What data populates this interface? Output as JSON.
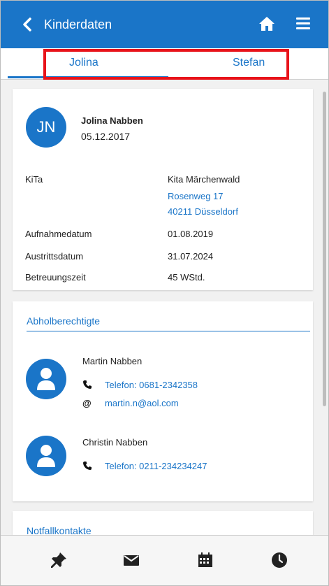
{
  "header": {
    "title": "Kinderdaten",
    "back_icon": "chevron-left-icon",
    "home_icon": "home-icon",
    "menu_icon": "hamburger-menu-icon",
    "color": "#1a75c8"
  },
  "tabs": [
    {
      "label": "Jolina",
      "active": true
    },
    {
      "label": "Stefan",
      "active": false
    }
  ],
  "child": {
    "initials": "JN",
    "name": "Jolina Nabben",
    "birthdate": "05.12.2017",
    "details": [
      {
        "label": "KiTa",
        "value": "Kita Märchenwald",
        "link1": "Rosenweg 17",
        "link2": "40211 Düsseldorf"
      },
      {
        "label": "Aufnahmedatum",
        "value": "01.08.2019"
      },
      {
        "label": "Austrittsdatum",
        "value": "31.07.2024"
      },
      {
        "label": "Betreuungszeit",
        "value": "45 WStd."
      }
    ]
  },
  "pickup": {
    "title": "Abholberechtigte",
    "persons": [
      {
        "name": "Martin Nabben",
        "phone": "Telefon: 0681-2342358",
        "email": "martin.n@aol.com"
      },
      {
        "name": "Christin Nabben",
        "phone": "Telefon: 0211-234234247"
      }
    ]
  },
  "emergency": {
    "title": "Notfallkontakte"
  },
  "bottom_nav": [
    "pin-icon",
    "mail-icon",
    "calendar-icon",
    "clock-icon"
  ]
}
